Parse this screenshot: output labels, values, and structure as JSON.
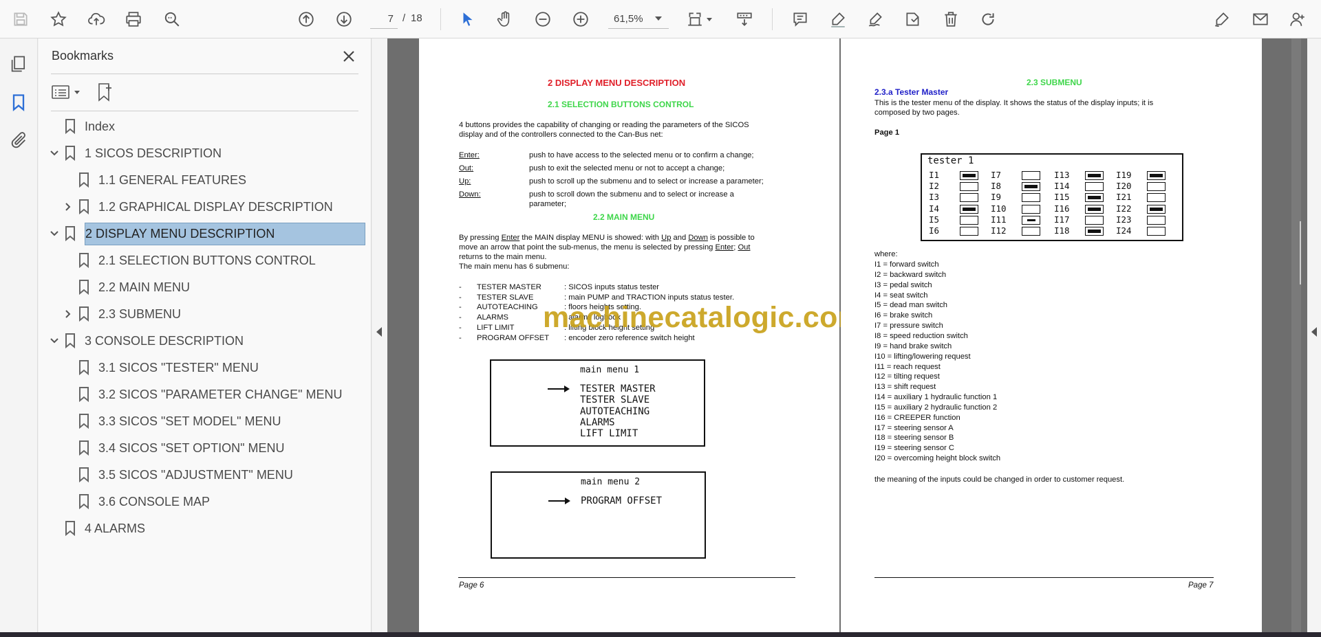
{
  "toolbar": {
    "page_current": "7",
    "page_separator": "/",
    "page_total": "18",
    "zoom": "61,5%"
  },
  "bookmarks": {
    "title": "Bookmarks",
    "items": [
      {
        "label": "Index",
        "level": 0,
        "chevron": "none"
      },
      {
        "label": "1 SICOS DESCRIPTION",
        "level": 0,
        "chevron": "down"
      },
      {
        "label": "1.1 GENERAL FEATURES",
        "level": 1,
        "chevron": "none"
      },
      {
        "label": "1.2 GRAPHICAL DISPLAY DESCRIPTION",
        "level": 1,
        "chevron": "right"
      },
      {
        "label": "2 DISPLAY MENU DESCRIPTION",
        "level": 0,
        "chevron": "down",
        "selected": true
      },
      {
        "label": "2.1 SELECTION BUTTONS CONTROL",
        "level": 1,
        "chevron": "none"
      },
      {
        "label": "2.2 MAIN MENU",
        "level": 1,
        "chevron": "none"
      },
      {
        "label": "2.3 SUBMENU",
        "level": 1,
        "chevron": "right"
      },
      {
        "label": "3 CONSOLE DESCRIPTION",
        "level": 0,
        "chevron": "down"
      },
      {
        "label": "3.1 SICOS \"TESTER\" MENU",
        "level": 1,
        "chevron": "none"
      },
      {
        "label": "3.2 SICOS \"PARAMETER CHANGE\" MENU",
        "level": 1,
        "chevron": "none"
      },
      {
        "label": "3.3 SICOS \"SET MODEL\" MENU",
        "level": 1,
        "chevron": "none"
      },
      {
        "label": "3.4 SICOS \"SET OPTION\" MENU",
        "level": 1,
        "chevron": "none"
      },
      {
        "label": "3.5 SICOS \"ADJUSTMENT\" MENU",
        "level": 1,
        "chevron": "none"
      },
      {
        "label": "3.6 CONSOLE MAP",
        "level": 1,
        "chevron": "none"
      },
      {
        "label": "4 ALARMS",
        "level": 0,
        "chevron": "none"
      }
    ]
  },
  "page6": {
    "heading": "2 DISPLAY MENU DESCRIPTION",
    "sub1": "2.1 SELECTION BUTTONS CONTROL",
    "intro1": "4 buttons provides the capability of changing or reading the parameters of the SICOS",
    "intro2": "display and of the controllers connected to the Can-Bus net:",
    "btn_enter_k": "Enter:",
    "btn_enter_v": "push to have access to the selected menu or to confirm a change;",
    "btn_out_k": "Out:",
    "btn_out_v": "push to exit the selected menu or not to accept a change;",
    "btn_up_k": "Up:",
    "btn_up_v": "push to scroll up the submenu and to select or increase a parameter;",
    "btn_down_k": "Down:",
    "btn_down_v1": "push to scroll down the submenu and to select or increase a",
    "btn_down_v2": "parameter;",
    "sub2": "2.2 MAIN MENU",
    "main_p1a": "By pressing ",
    "main_p1b": "Enter",
    "main_p1c": " the MAIN display MENU is showed: with ",
    "main_p1d": "Up",
    "main_p1e": " and ",
    "main_p1f": "Down",
    "main_p1g": " is possible to",
    "main_p2a": "move an arrow that point the sub-menus, the menu is selected by pressing ",
    "main_p2b": "Enter",
    "main_p2c": "; ",
    "main_p2d": "Out",
    "main_p3": "returns to the main menu.",
    "main_p4": "The main menu has 6 submenu:",
    "submenus": [
      {
        "name": "TESTER MASTER",
        "desc": ": SICOS inputs status tester"
      },
      {
        "name": "TESTER SLAVE",
        "desc": ": main PUMP and TRACTION inputs status tester."
      },
      {
        "name": "AUTOTEACHING",
        "desc": ": floors heights setting."
      },
      {
        "name": "ALARMS",
        "desc": ": alarms logbook"
      },
      {
        "name": "LIFT LIMIT",
        "desc": ": lifting block height setting"
      },
      {
        "name": "PROGRAM OFFSET",
        "desc": ": encoder zero reference switch height"
      }
    ],
    "menu1_title": "main menu 1",
    "menu1_items": [
      "TESTER MASTER",
      "TESTER SLAVE",
      "AUTOTEACHING",
      "ALARMS",
      "LIFT LIMIT"
    ],
    "menu2_title": "main menu 2",
    "menu2_items": [
      "PROGRAM OFFSET"
    ],
    "footer": "Page 6"
  },
  "page7": {
    "heading": "2.3 SUBMENU",
    "sub": "2.3.a Tester Master",
    "p1": "This is the tester menu of the display. It shows the status of the display inputs; it is",
    "p2": "composed by two pages.",
    "page_label": "Page 1",
    "tester_title": "tester 1",
    "tester_cols": [
      [
        {
          "l": "I1",
          "s": "on"
        },
        {
          "l": "I2",
          "s": "off"
        },
        {
          "l": "I3",
          "s": "off"
        },
        {
          "l": "I4",
          "s": "on"
        },
        {
          "l": "I5",
          "s": "off"
        },
        {
          "l": "I6",
          "s": "off"
        }
      ],
      [
        {
          "l": "I7",
          "s": "off"
        },
        {
          "l": "I8",
          "s": "on"
        },
        {
          "l": "I9",
          "s": "off"
        },
        {
          "l": "I10",
          "s": "off"
        },
        {
          "l": "I11",
          "s": "half"
        },
        {
          "l": "I12",
          "s": "off"
        }
      ],
      [
        {
          "l": "I13",
          "s": "on"
        },
        {
          "l": "I14",
          "s": "off"
        },
        {
          "l": "I15",
          "s": "on"
        },
        {
          "l": "I16",
          "s": "on"
        },
        {
          "l": "I17",
          "s": "off"
        },
        {
          "l": "I18",
          "s": "on"
        }
      ],
      [
        {
          "l": "I19",
          "s": "on"
        },
        {
          "l": "I20",
          "s": "off"
        },
        {
          "l": "I21",
          "s": "off"
        },
        {
          "l": "I22",
          "s": "on"
        },
        {
          "l": "I23",
          "s": "off"
        },
        {
          "l": "I24",
          "s": "off"
        }
      ]
    ],
    "where": "where:",
    "inputs": [
      "I1  = forward switch",
      "I2  = backward switch",
      "I3  = pedal switch",
      "I4  = seat switch",
      "I5  = dead man switch",
      "I6  = brake switch",
      "I7  = pressure switch",
      "I8  = speed reduction switch",
      "I9  = hand brake switch",
      "I10 = lifting/lowering request",
      "I11 = reach request",
      "I12 = tilting request",
      "I13 = shift request",
      "I14 = auxiliary 1 hydraulic function 1",
      "I15 = auxiliary 2 hydraulic function 2",
      "I16 = CREEPER function",
      "I17 = steering sensor A",
      "I18 = steering sensor B",
      "I19 = steering sensor C",
      "I20 = overcoming height block switch"
    ],
    "closing": "the meaning of the inputs could be changed in order to customer request.",
    "footer": "Page 7"
  },
  "watermark": "machinecatalogic.com",
  "colors": {
    "selected_bookmark": "#a5c4e0",
    "toolbar_icon": "#555555",
    "select_tool": "#2d6fd6",
    "heading_red": "#e0202a",
    "heading_green": "#3ed64a",
    "heading_blue": "#2020c8"
  }
}
